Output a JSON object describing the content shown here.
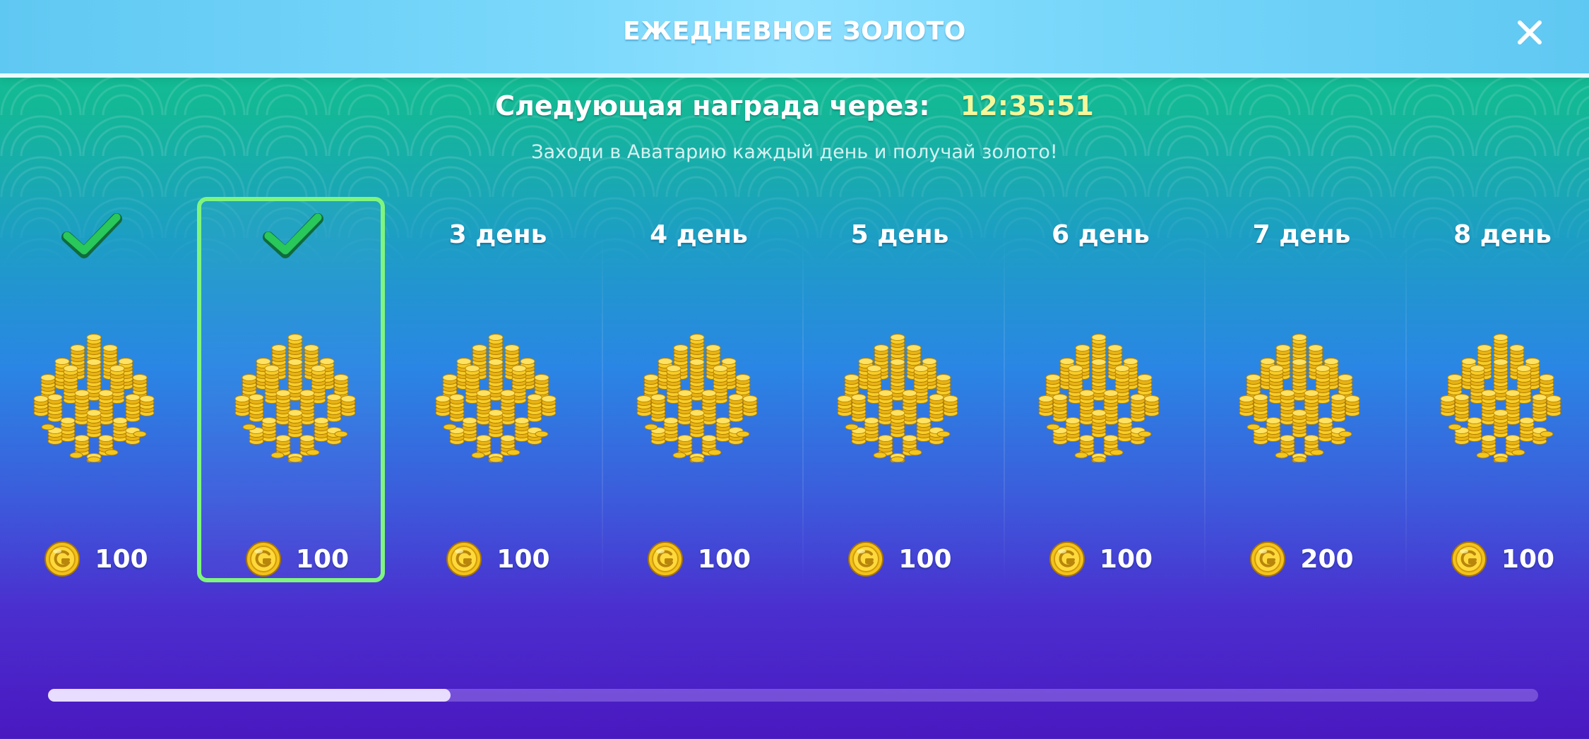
{
  "header": {
    "title": "ЕЖЕДНЕВНОЕ ЗОЛОТО",
    "close_icon": "close-icon"
  },
  "next_reward": {
    "label": "Следующая награда через:",
    "timer": "12:35:51"
  },
  "subtitle": "Заходи в Аватарию каждый день и получай золото!",
  "days": [
    {
      "label": "",
      "claimed": true,
      "selected": false,
      "amount": "100"
    },
    {
      "label": "",
      "claimed": true,
      "selected": true,
      "amount": "100"
    },
    {
      "label": "3 день",
      "claimed": false,
      "selected": false,
      "amount": "100"
    },
    {
      "label": "4 день",
      "claimed": false,
      "selected": false,
      "amount": "100"
    },
    {
      "label": "5 день",
      "claimed": false,
      "selected": false,
      "amount": "100"
    },
    {
      "label": "6 день",
      "claimed": false,
      "selected": false,
      "amount": "100"
    },
    {
      "label": "7 день",
      "claimed": false,
      "selected": false,
      "amount": "200"
    },
    {
      "label": "8 день",
      "claimed": false,
      "selected": false,
      "amount": "100"
    }
  ],
  "scroll": {
    "position_fraction": 0.27
  },
  "colors": {
    "accent_green": "#7ff57e",
    "timer": "#f4f79a",
    "gold": "#f2c21b"
  }
}
